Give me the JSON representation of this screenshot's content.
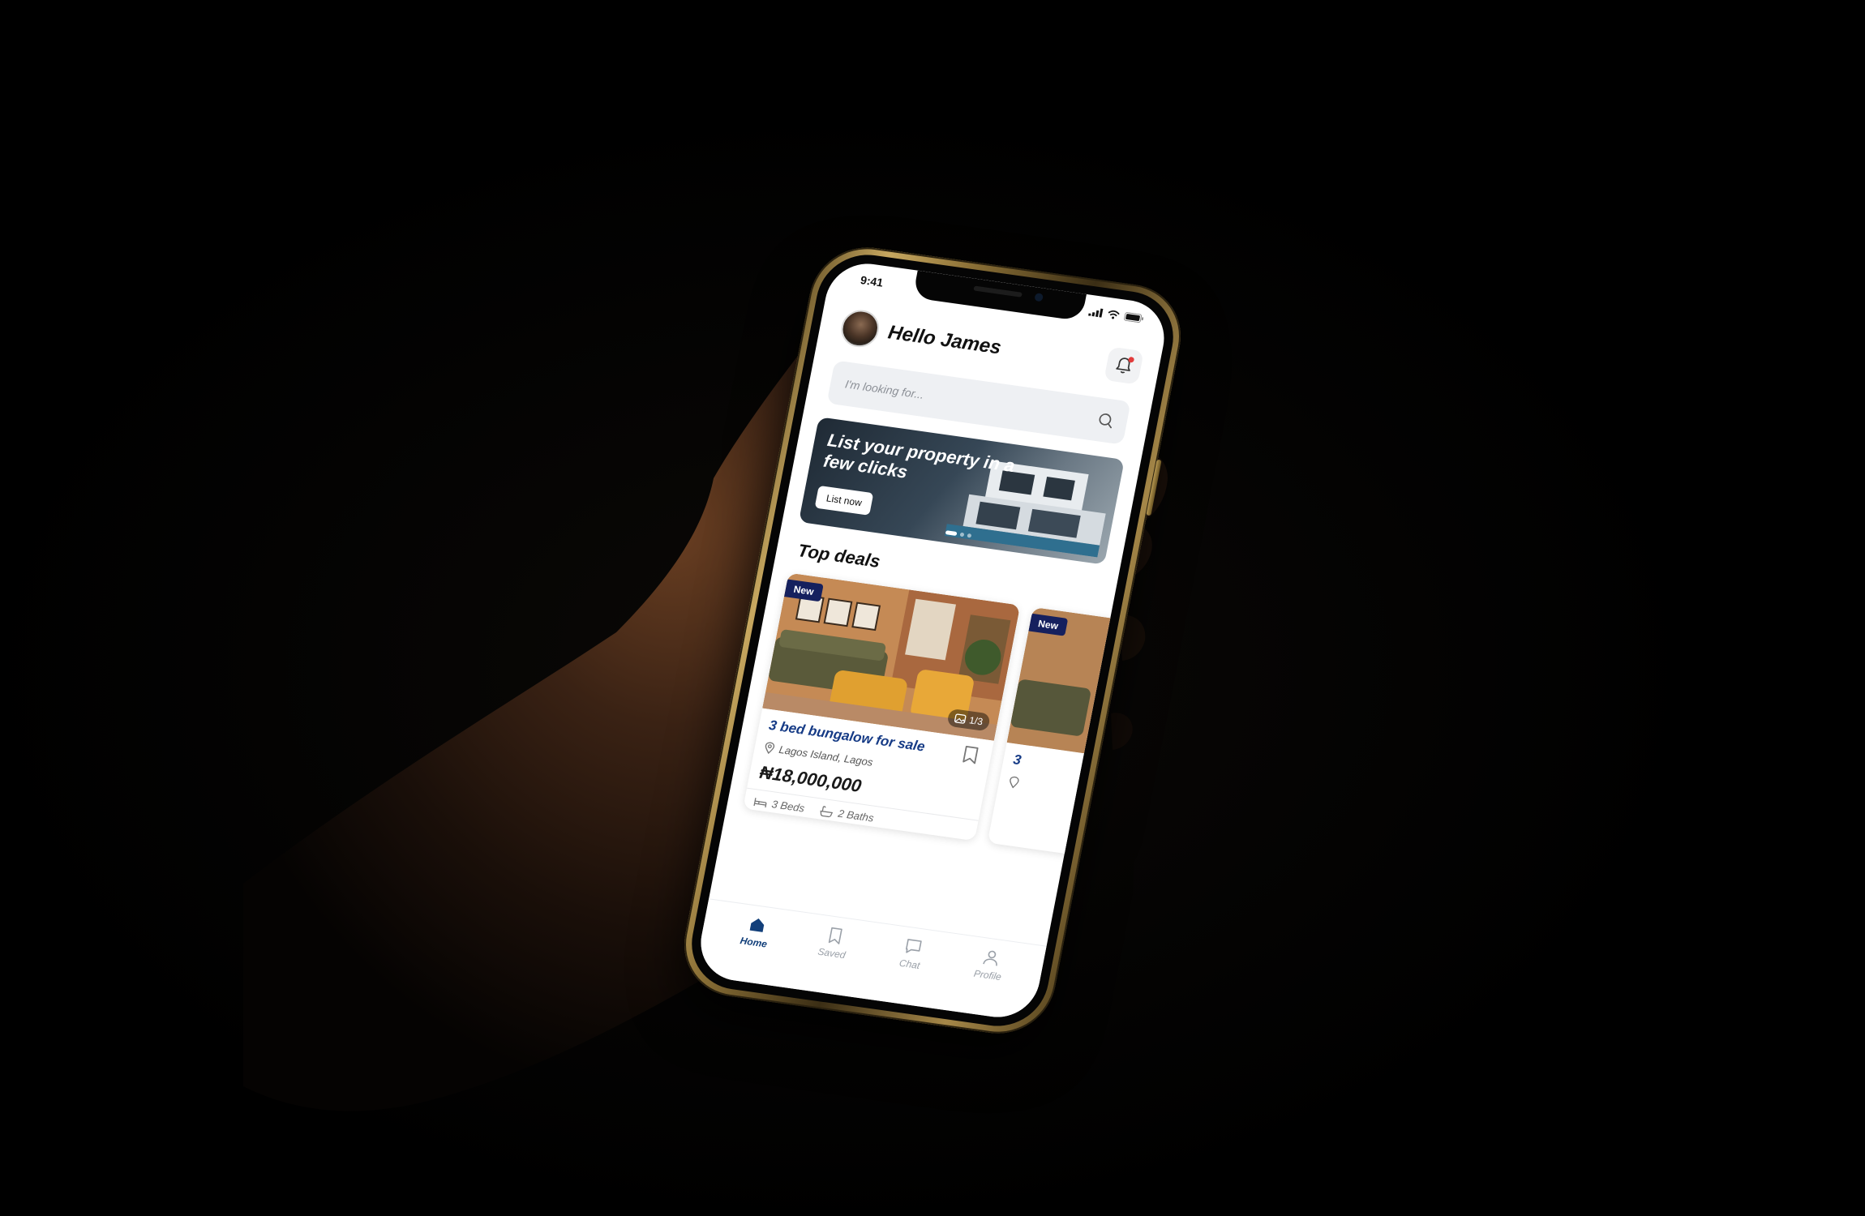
{
  "status_bar": {
    "time": "9:41"
  },
  "header": {
    "greeting": "Hello James"
  },
  "search": {
    "placeholder": "I'm looking for..."
  },
  "banner": {
    "title": "List your property in a few clicks",
    "button_label": "List now",
    "slide_count": 3,
    "active_slide": 1
  },
  "top_deals": {
    "title": "Top deals",
    "cards": [
      {
        "badge": "New",
        "image_counter": "1/3",
        "title": "3 bed bungalow for sale",
        "location": "Lagos Island, Lagos",
        "price": "₦18,000,000",
        "beds": "3 Beds",
        "baths": "2 Baths"
      },
      {
        "badge": "New",
        "title": "3"
      }
    ]
  },
  "bottom_nav": {
    "items": [
      {
        "label": "Home",
        "icon": "home-icon",
        "active": true
      },
      {
        "label": "Saved",
        "icon": "bookmark-icon",
        "active": false
      },
      {
        "label": "Chat",
        "icon": "chat-icon",
        "active": false
      },
      {
        "label": "Profile",
        "icon": "profile-icon",
        "active": false
      }
    ]
  },
  "colors": {
    "primary": "#123f7a",
    "badge": "#15205e",
    "notification_dot": "#e23b3b",
    "phone_frame": "#c8a860"
  }
}
